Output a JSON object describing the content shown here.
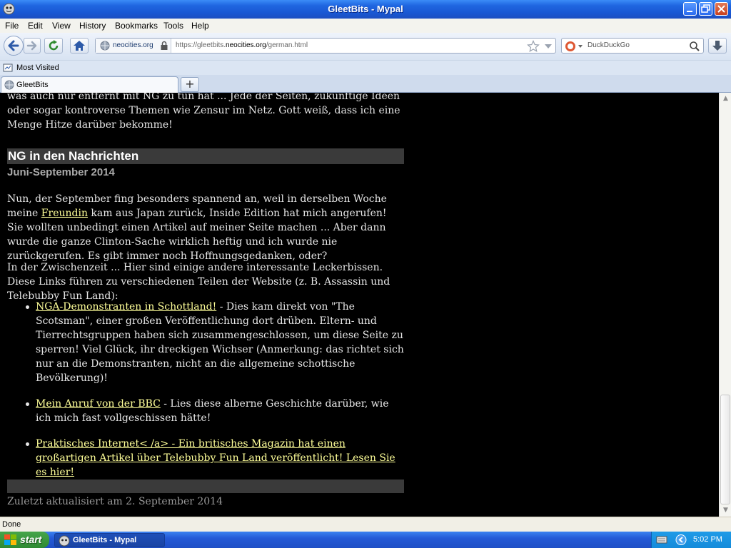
{
  "window": {
    "title": "GleetBits - Mypal"
  },
  "menu": {
    "items": [
      "File",
      "Edit",
      "View",
      "History",
      "Bookmarks",
      "Tools",
      "Help"
    ]
  },
  "navbar": {
    "site_identity": "neocities.org",
    "url_prefix": "https://gleetbits.",
    "url_host": "neocities.org",
    "url_path": "/german.html",
    "search_placeholder": "DuckDuckGo"
  },
  "bookmarks": {
    "most_visited": "Most Visited"
  },
  "tabs": [
    {
      "label": "GleetBits"
    }
  ],
  "page": {
    "intro_text": "was auch nur entfernt mit NG zu tun hat ... Jede der Seiten, zukünftige Ideen oder sogar kontroverse Themen wie Zensur im Netz. Gott weiß, dass ich eine Menge Hitze darüber bekomme!",
    "section_heading": "NG in den Nachrichten",
    "section_subheading": "Juni-September 2014",
    "para1_before": "Nun, der September fing besonders spannend an, weil in derselben Woche meine ",
    "para1_link": "Freundin",
    "para1_after": " kam aus Japan zurück, Inside Edition hat mich angerufen! Sie wollten unbedingt einen Artikel auf meiner Seite machen ... Aber dann wurde die ganze Clinton-Sache wirklich heftig und ich wurde nie zurückgerufen. Es gibt immer noch Hoffnungsgedanken, oder?",
    "para2": "In der Zwischenzeit ... Hier sind einige andere interessante Leckerbissen. Diese Links führen zu verschiedenen Teilen der Website (z. B. Assassin und Telebubby Fun Land):",
    "bullets": [
      {
        "link": "NGA-Demonstranten in Schottland!",
        "text": " - Dies kam direkt von \"The Scotsman\", einer großen Veröffentlichung dort drüben. Eltern- und Tierrechtsgruppen haben sich zusammengeschlossen, um diese Seite zu sperren! Viel Glück, ihr dreckigen Wichser (Anmerkung: das richtet sich nur an die Demonstranten, nicht an die allgemeine schottische Bevölkerung)!"
      },
      {
        "link": "Mein Anruf von der BBC",
        "text": " - Lies diese alberne Geschichte darüber, wie ich mich fast vollgeschissen hätte!"
      },
      {
        "link": "Praktisches Internet< /a> - Ein britisches Magazin hat einen großartigen Artikel über Telebubby Fun Land veröffentlicht! Lesen Sie es hier!",
        "text": ""
      }
    ],
    "footer": "Zuletzt aktualisiert am 2. September 2014"
  },
  "status": {
    "text": "Done"
  },
  "taskbar": {
    "start_label": "start",
    "task_label": "GleetBits - Mypal",
    "clock": "5:02 PM"
  },
  "colors": {
    "link": "#ffff99",
    "heading_bar": "#3a3a3a",
    "page_background": "#000000"
  }
}
